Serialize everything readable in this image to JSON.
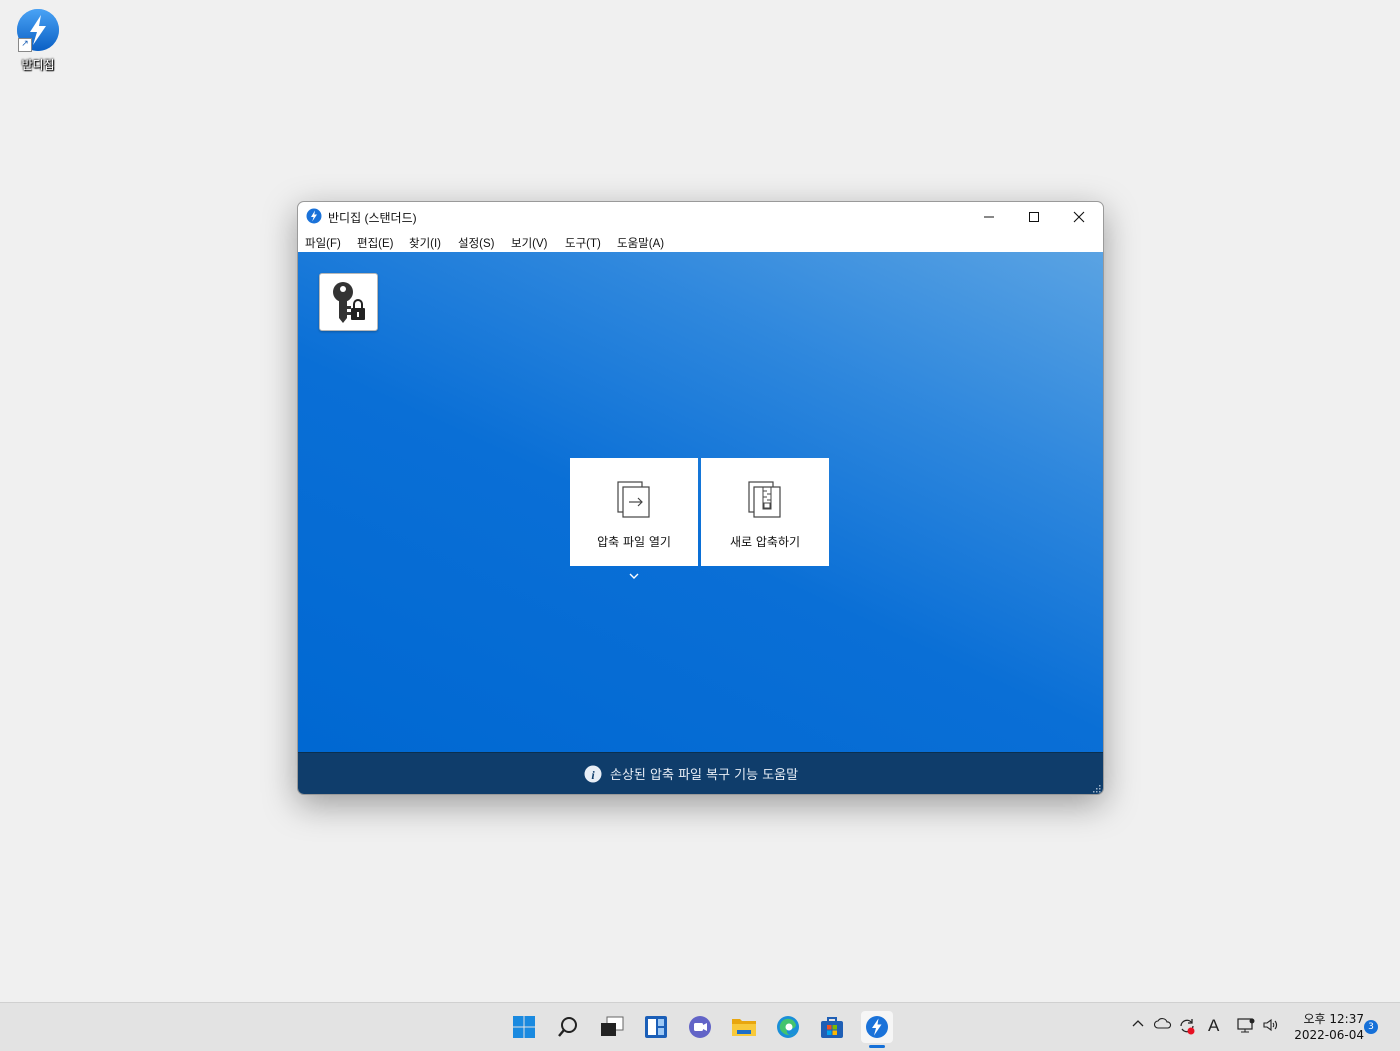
{
  "desktop": {
    "shortcut_label": "반디집"
  },
  "window": {
    "title": "반디집 (스탠더드)",
    "menu": [
      "파일(F)",
      "편집(E)",
      "찾기(I)",
      "설정(S)",
      "보기(V)",
      "도구(T)",
      "도움말(A)"
    ],
    "tiles": {
      "open_label": "압축 파일 열기",
      "new_label": "새로 압축하기"
    },
    "status_help": "손상된 압축 파일 복구 기능 도움말"
  },
  "taskbar": {
    "clock_period": "오후 12:37",
    "clock_date": "2022-06-04",
    "notifications": "3",
    "ime_indicator": "A"
  },
  "icons": {
    "app": "bandizip-icon",
    "key": "password-key-icon",
    "open": "open-archive-icon",
    "new": "new-archive-icon"
  },
  "colors": {
    "accent": "#0068d2",
    "status_bar": "#0f3d6b"
  }
}
